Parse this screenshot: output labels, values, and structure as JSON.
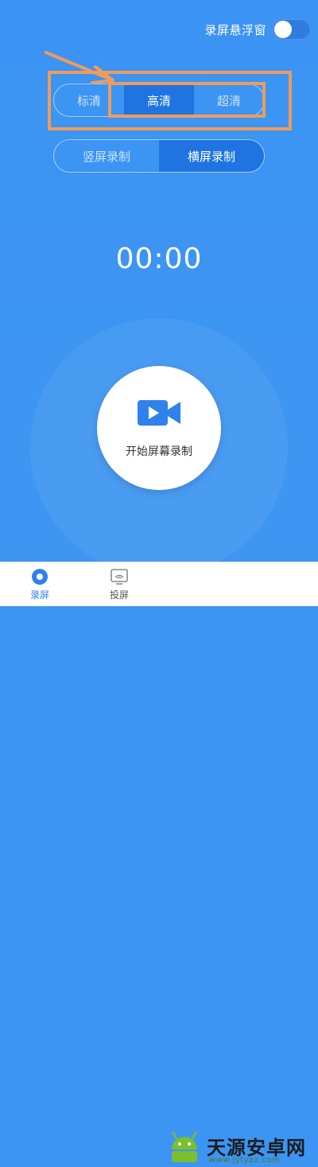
{
  "floating_toggle": {
    "label": "录屏悬浮窗",
    "on": false
  },
  "quality": {
    "options": [
      "标清",
      "高清",
      "超清"
    ],
    "selected": "高清"
  },
  "orientation": {
    "options": [
      "竖屏录制",
      "横屏录制"
    ],
    "selected": "横屏录制"
  },
  "timer": "00:00",
  "record_button": {
    "label": "开始屏幕录制",
    "icon": "video-camera-icon"
  },
  "bottom_nav": [
    {
      "label": "录屏",
      "icon": "record-icon",
      "active": true
    },
    {
      "label": "投屏",
      "icon": "cast-icon",
      "active": false
    }
  ],
  "watermark": {
    "title": "天源安卓网",
    "url": "www.jytyaz.com"
  },
  "colors": {
    "background": "#3c95f3",
    "active_segment": "#1f74e2",
    "annotation": "#f19b5b",
    "nav_active": "#2f82ec"
  }
}
